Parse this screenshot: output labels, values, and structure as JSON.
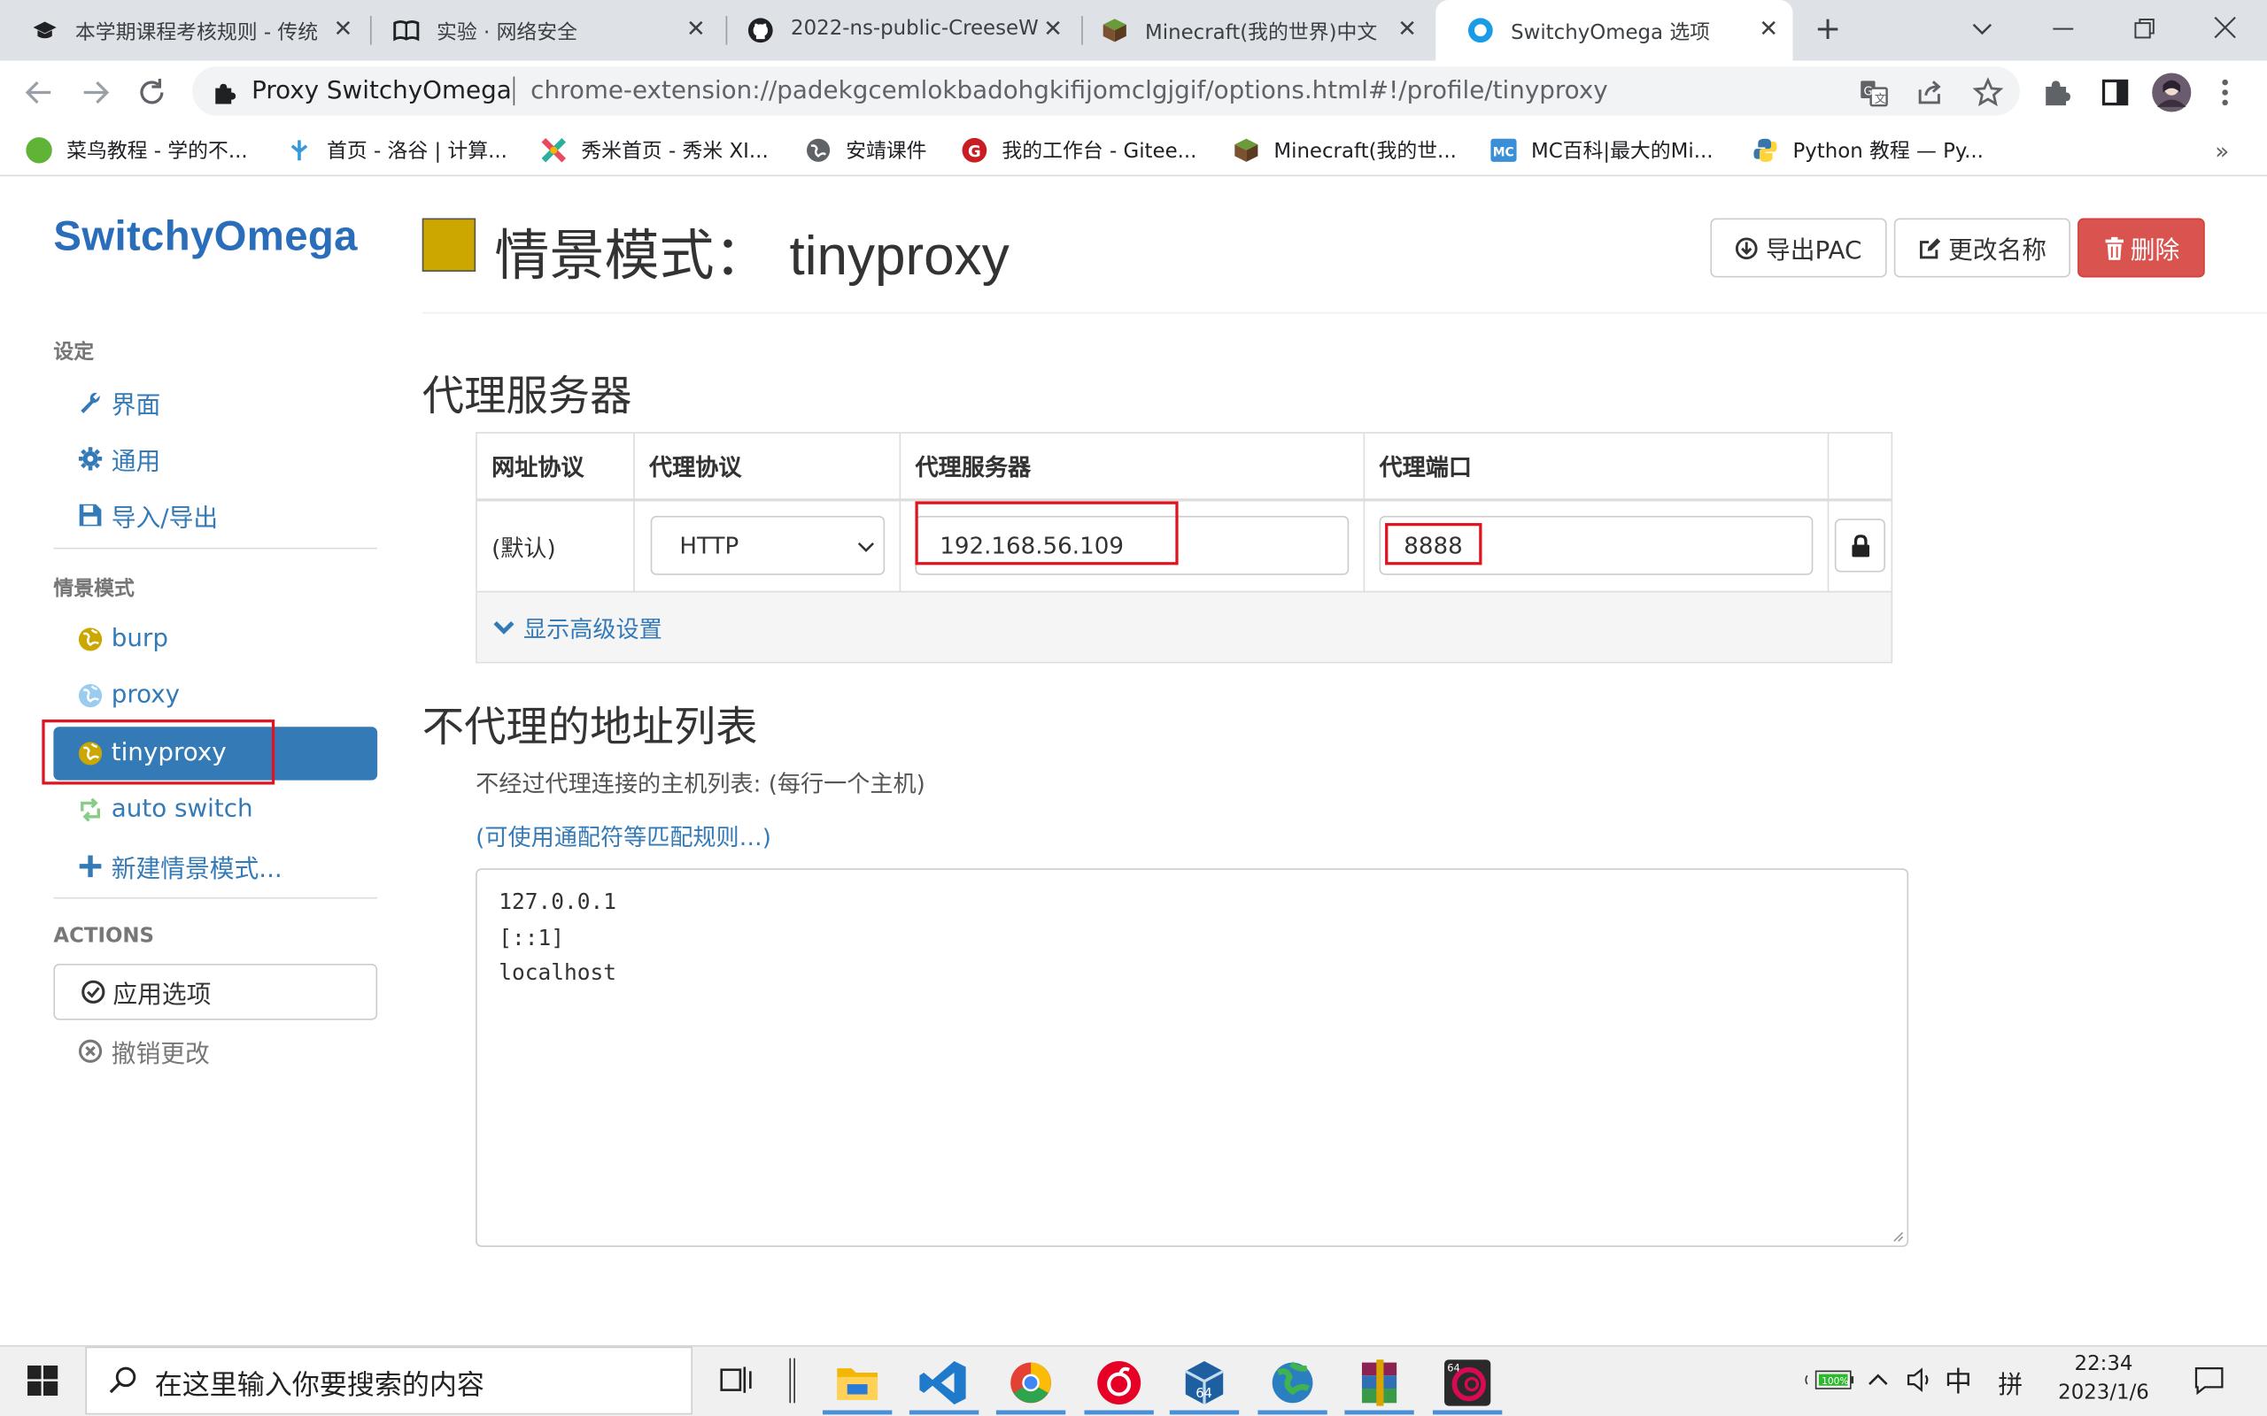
{
  "browser": {
    "tabs": [
      {
        "title": "本学期课程考核规则 - 传统",
        "icon": "graduation-cap-icon",
        "active": false
      },
      {
        "title": "实验 · 网络安全",
        "icon": "book-icon",
        "active": false
      },
      {
        "title": "2022-ns-public-CreeseW",
        "icon": "github-icon",
        "active": false
      },
      {
        "title": "Minecraft(我的世界)中文",
        "icon": "minecraft-block-icon",
        "active": false
      },
      {
        "title": "SwitchyOmega 选项",
        "icon": "switchyomega-icon",
        "active": true
      }
    ],
    "new_tab_label": "+",
    "omnibox": {
      "site": "Proxy SwitchyOmega",
      "url": "chrome-extension://padekgcemlokbadohgkifijomclgjgif/options.html#!/profile/tinyproxy"
    },
    "bookmarks": [
      {
        "label": "菜鸟教程 - 学的不...",
        "icon": "runoob-icon",
        "color": "#5fb336"
      },
      {
        "label": "首页 - 洛谷 | 计算...",
        "icon": "luogu-icon",
        "color": "#3498db"
      },
      {
        "label": "秀米首页 - 秀米 XI...",
        "icon": "xiumi-icon",
        "color": "#e84a5f"
      },
      {
        "label": "安靖课件",
        "icon": "globe-icon",
        "color": "#5f6368"
      },
      {
        "label": "我的工作台 - Gitee...",
        "icon": "gitee-icon",
        "color": "#c71d23"
      },
      {
        "label": "Minecraft(我的世...",
        "icon": "minecraft-block-icon",
        "color": "#7a5230"
      },
      {
        "label": "MC百科|最大的Mi...",
        "icon": "mcmod-icon",
        "color": "#3a8fd6"
      },
      {
        "label": "Python 教程 — Py...",
        "icon": "python-icon",
        "color": "#3776ab"
      }
    ],
    "bookmarks_overflow": "»"
  },
  "app": {
    "brand": "SwitchyOmega",
    "nav": {
      "settings_header": "设定",
      "settings_items": [
        {
          "label": "界面",
          "icon": "wrench-icon"
        },
        {
          "label": "通用",
          "icon": "gear-icon"
        },
        {
          "label": "导入/导出",
          "icon": "floppy-icon"
        }
      ],
      "profiles_header": "情景模式",
      "profiles": [
        {
          "label": "burp",
          "icon": "globe-icon",
          "color": "#cca700"
        },
        {
          "label": "proxy",
          "icon": "globe-icon",
          "color": "#99ccee"
        },
        {
          "label": "tinyproxy",
          "icon": "globe-icon",
          "color": "#cca700",
          "active": true
        },
        {
          "label": "auto switch",
          "icon": "retweet-icon",
          "color": "#99dd99"
        },
        {
          "label": "新建情景模式...",
          "icon": "plus-icon",
          "color": "#337ab7"
        }
      ],
      "actions_header": "ACTIONS",
      "apply_label": "应用选项",
      "discard_label": "撤销更改"
    },
    "header": {
      "title_prefix": "情景模式：",
      "profile_name": "tinyproxy",
      "profile_color": "#cca700",
      "export_pac": "导出PAC",
      "rename": "更改名称",
      "delete": "删除"
    },
    "proxy_servers": {
      "heading": "代理服务器",
      "columns": [
        "网址协议",
        "代理协议",
        "代理服务器",
        "代理端口"
      ],
      "row": {
        "scheme": "(默认)",
        "protocol": "HTTP",
        "server": "192.168.56.109",
        "port": "8888"
      },
      "advanced_link": "显示高级设置"
    },
    "bypass": {
      "heading": "不代理的地址列表",
      "description": "不经过代理连接的主机列表: (每行一个主机)",
      "wildcard_link": "(可使用通配符等匹配规则…)",
      "entries": [
        "127.0.0.1",
        "[::1]",
        "localhost"
      ]
    }
  },
  "taskbar": {
    "search_placeholder": "在这里输入你要搜索的内容",
    "apps": [
      {
        "name": "file-explorer-icon",
        "color": "#f2b705"
      },
      {
        "name": "vscode-icon",
        "color": "#1f7acc"
      },
      {
        "name": "chrome-icon",
        "color": "#e34133"
      },
      {
        "name": "netease-music-icon",
        "color": "#e60026"
      },
      {
        "name": "virtualbox-icon",
        "color": "#1d5fa0"
      },
      {
        "name": "network-globe-icon",
        "color": "#2e8b57"
      },
      {
        "name": "winrar-icon",
        "color": "#8b2252"
      },
      {
        "name": "debian-vm-icon",
        "color": "#c70036"
      }
    ],
    "tray": {
      "battery": "100%",
      "ime_lang": "中",
      "ime_mode": "拼",
      "time": "22:34",
      "date": "2023/1/6"
    }
  }
}
